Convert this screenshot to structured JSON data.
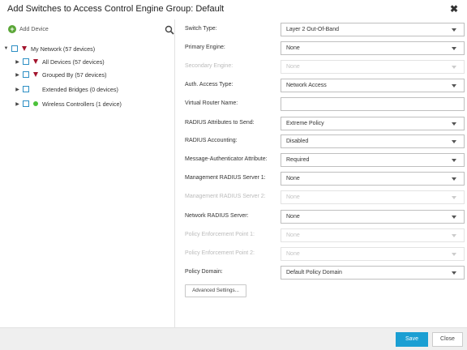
{
  "dialog": {
    "title": "Add Switches to Access Control Engine Group: Default",
    "close_icon": "close-icon"
  },
  "left_panel": {
    "add_device_label": "Add Device",
    "tree": [
      {
        "label": "My Network (57 devices)",
        "icon": "red-triangle-icon"
      },
      {
        "label": "All Devices (57 devices)",
        "icon": "red-triangle-icon"
      },
      {
        "label": "Grouped By (57 devices)",
        "icon": "red-triangle-icon"
      },
      {
        "label": "Extended Bridges (0 devices)",
        "icon": "none"
      },
      {
        "label": "Wireless Controllers (1 device)",
        "icon": "green-dot-icon"
      }
    ]
  },
  "form": {
    "switch_type": {
      "label": "Switch Type:",
      "value": "Layer 2 Out-Of-Band"
    },
    "primary_engine": {
      "label": "Primary Engine:",
      "value": "None"
    },
    "secondary_engine": {
      "label": "Secondary Engine:",
      "value": "None"
    },
    "auth_access_type": {
      "label": "Auth. Access Type:",
      "value": "Network Access"
    },
    "virtual_router_name": {
      "label": "Virtual Router Name:",
      "value": ""
    },
    "radius_attributes": {
      "label": "RADIUS Attributes to Send:",
      "value": "Extreme Policy"
    },
    "radius_accounting": {
      "label": "RADIUS Accounting:",
      "value": "Disabled"
    },
    "message_authenticator": {
      "label": "Message-Authenticator Attribute:",
      "value": "Required"
    },
    "mgmt_radius_1": {
      "label": "Management RADIUS Server 1:",
      "value": "None"
    },
    "mgmt_radius_2": {
      "label": "Management RADIUS Server 2:",
      "value": "None"
    },
    "network_radius": {
      "label": "Network RADIUS Server:",
      "value": "None"
    },
    "pep_1": {
      "label": "Policy Enforcement Point 1:",
      "value": "None"
    },
    "pep_2": {
      "label": "Policy Enforcement Point 2:",
      "value": "None"
    },
    "policy_domain": {
      "label": "Policy Domain:",
      "value": "Default Policy Domain"
    },
    "advanced_settings_label": "Advanced Settings..."
  },
  "footer": {
    "save_label": "Save",
    "close_label": "Close"
  },
  "colors": {
    "accent": "#1b9fd3",
    "triangle": "#a3142d",
    "green": "#4cc23a",
    "add_icon": "#5aa637"
  }
}
